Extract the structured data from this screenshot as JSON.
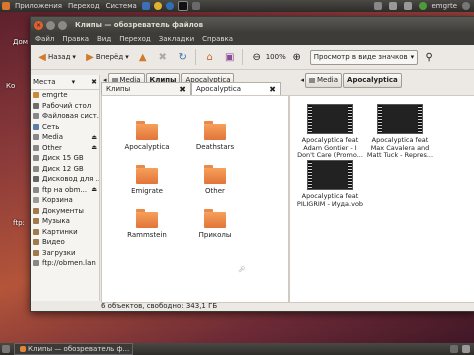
{
  "top_panel": {
    "menus": [
      "Приложения",
      "Переход",
      "Система"
    ],
    "user": "emgrte"
  },
  "desktop": {
    "labels": [
      "Дом",
      "Ко",
      "ftp:"
    ]
  },
  "window": {
    "title": "Клипы — обозреватель файлов",
    "menu": [
      "Файл",
      "Правка",
      "Вид",
      "Переход",
      "Закладки",
      "Справка"
    ],
    "toolbar": {
      "back": "Назад",
      "forward": "Вперёд",
      "zoom": "100%",
      "view_mode": "Просмотр в виде значков"
    },
    "left_path": [
      "Media",
      "Клипы",
      "Apocalyptica"
    ],
    "right_path": [
      "Media",
      "Apocalyptica"
    ]
  },
  "sidebar": {
    "header": "Места",
    "items": [
      {
        "label": "emgrte",
        "icon": "home-icon",
        "color": "#c98a3a",
        "eject": false
      },
      {
        "label": "Рабочий стол",
        "icon": "desktop-icon",
        "color": "#6d6d6d",
        "eject": false
      },
      {
        "label": "Файловая сист...",
        "icon": "drive-icon",
        "color": "#888888",
        "eject": false
      },
      {
        "label": "Сеть",
        "icon": "network-icon",
        "color": "#5b7fa8",
        "eject": false
      },
      {
        "label": "Media",
        "icon": "drive-icon",
        "color": "#888888",
        "eject": true
      },
      {
        "label": "Other",
        "icon": "drive-icon",
        "color": "#888888",
        "eject": true
      },
      {
        "label": "Диск 15 GB",
        "icon": "drive-icon",
        "color": "#888888",
        "eject": false
      },
      {
        "label": "Диск 12 GB",
        "icon": "drive-icon",
        "color": "#888888",
        "eject": false
      },
      {
        "label": "Дисковод для ...",
        "icon": "floppy-icon",
        "color": "#666666",
        "eject": true
      },
      {
        "label": "ftp на obm...",
        "icon": "ftp-icon",
        "color": "#888888",
        "eject": true
      },
      {
        "label": "Корзина",
        "icon": "trash-icon",
        "color": "#999999",
        "eject": false
      },
      {
        "label": "Документы",
        "icon": "folder-icon",
        "color": "#a07a4a",
        "eject": false
      },
      {
        "label": "Музыка",
        "icon": "folder-icon",
        "color": "#a07a4a",
        "eject": false
      },
      {
        "label": "Картинки",
        "icon": "folder-icon",
        "color": "#a07a4a",
        "eject": false
      },
      {
        "label": "Видео",
        "icon": "folder-icon",
        "color": "#a07a4a",
        "eject": false
      },
      {
        "label": "Загрузки",
        "icon": "folder-icon",
        "color": "#a07a4a",
        "eject": false
      },
      {
        "label": "ftp://obmen.lan",
        "icon": "ftp-icon",
        "color": "#888888",
        "eject": false
      }
    ]
  },
  "left_pane": {
    "tab_label": "Клипы",
    "folders": [
      "Apocalyptica",
      "Deathstars",
      "Emigrate",
      "Other",
      "Rammstein",
      "Приколы"
    ]
  },
  "right_pane": {
    "tab_label": "Apocalyptica",
    "videos": [
      {
        "name": "Apocalyptica feat Adam Gontier - I Don't Care (Promo..."
      },
      {
        "name": "Apocalyptica feat Max Cavalera and Matt Tuck - Repres..."
      },
      {
        "name": "Apocalyptica feat PILIGRIM - Иуда.vob"
      }
    ]
  },
  "status": "6 объектов, свободно: 343,1 ГБ",
  "taskbar": {
    "task": "Клипы — обозреватель ф..."
  }
}
